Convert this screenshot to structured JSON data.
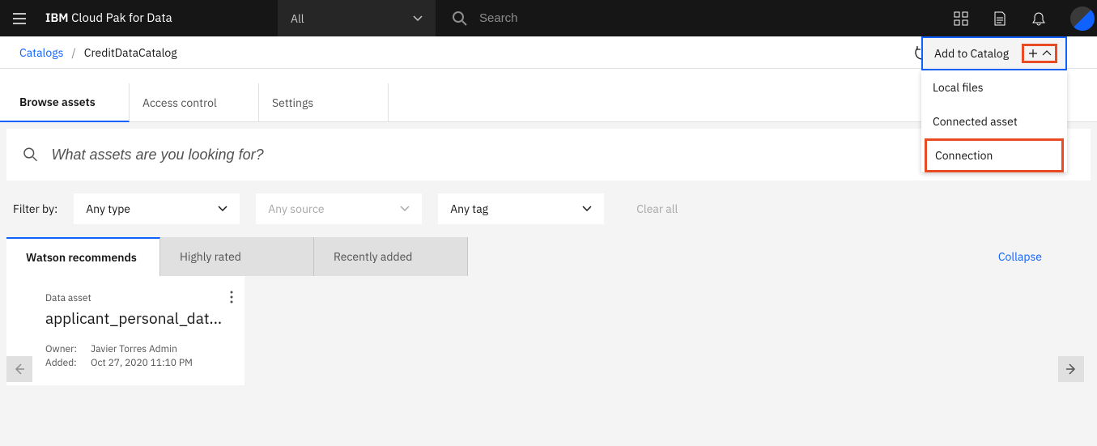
{
  "header": {
    "brand_prefix": "IBM",
    "brand_suffix": " Cloud Pak for Data",
    "scope_dropdown": "All",
    "search_placeholder": "Search"
  },
  "breadcrumb": {
    "root": "Catalogs",
    "separator": "/",
    "current": "CreditDataCatalog"
  },
  "add_dropdown": {
    "label": "Add to Catalog",
    "items": [
      "Local files",
      "Connected asset",
      "Connection"
    ]
  },
  "page_tabs": [
    "Browse assets",
    "Access control",
    "Settings"
  ],
  "asset_search": {
    "placeholder": "What assets are you looking for?"
  },
  "filters": {
    "label": "Filter by:",
    "type": "Any type",
    "source": "Any source",
    "tag": "Any tag",
    "clear": "Clear all"
  },
  "rec_tabs": [
    "Watson recommends",
    "Highly rated",
    "Recently added"
  ],
  "collapse": "Collapse",
  "card": {
    "type": "Data asset",
    "name": "applicant_personal_dat...",
    "owner_label": "Owner:",
    "owner": "Javier Torres Admin",
    "added_label": "Added:",
    "added": "Oct 27, 2020 11:10 PM"
  }
}
